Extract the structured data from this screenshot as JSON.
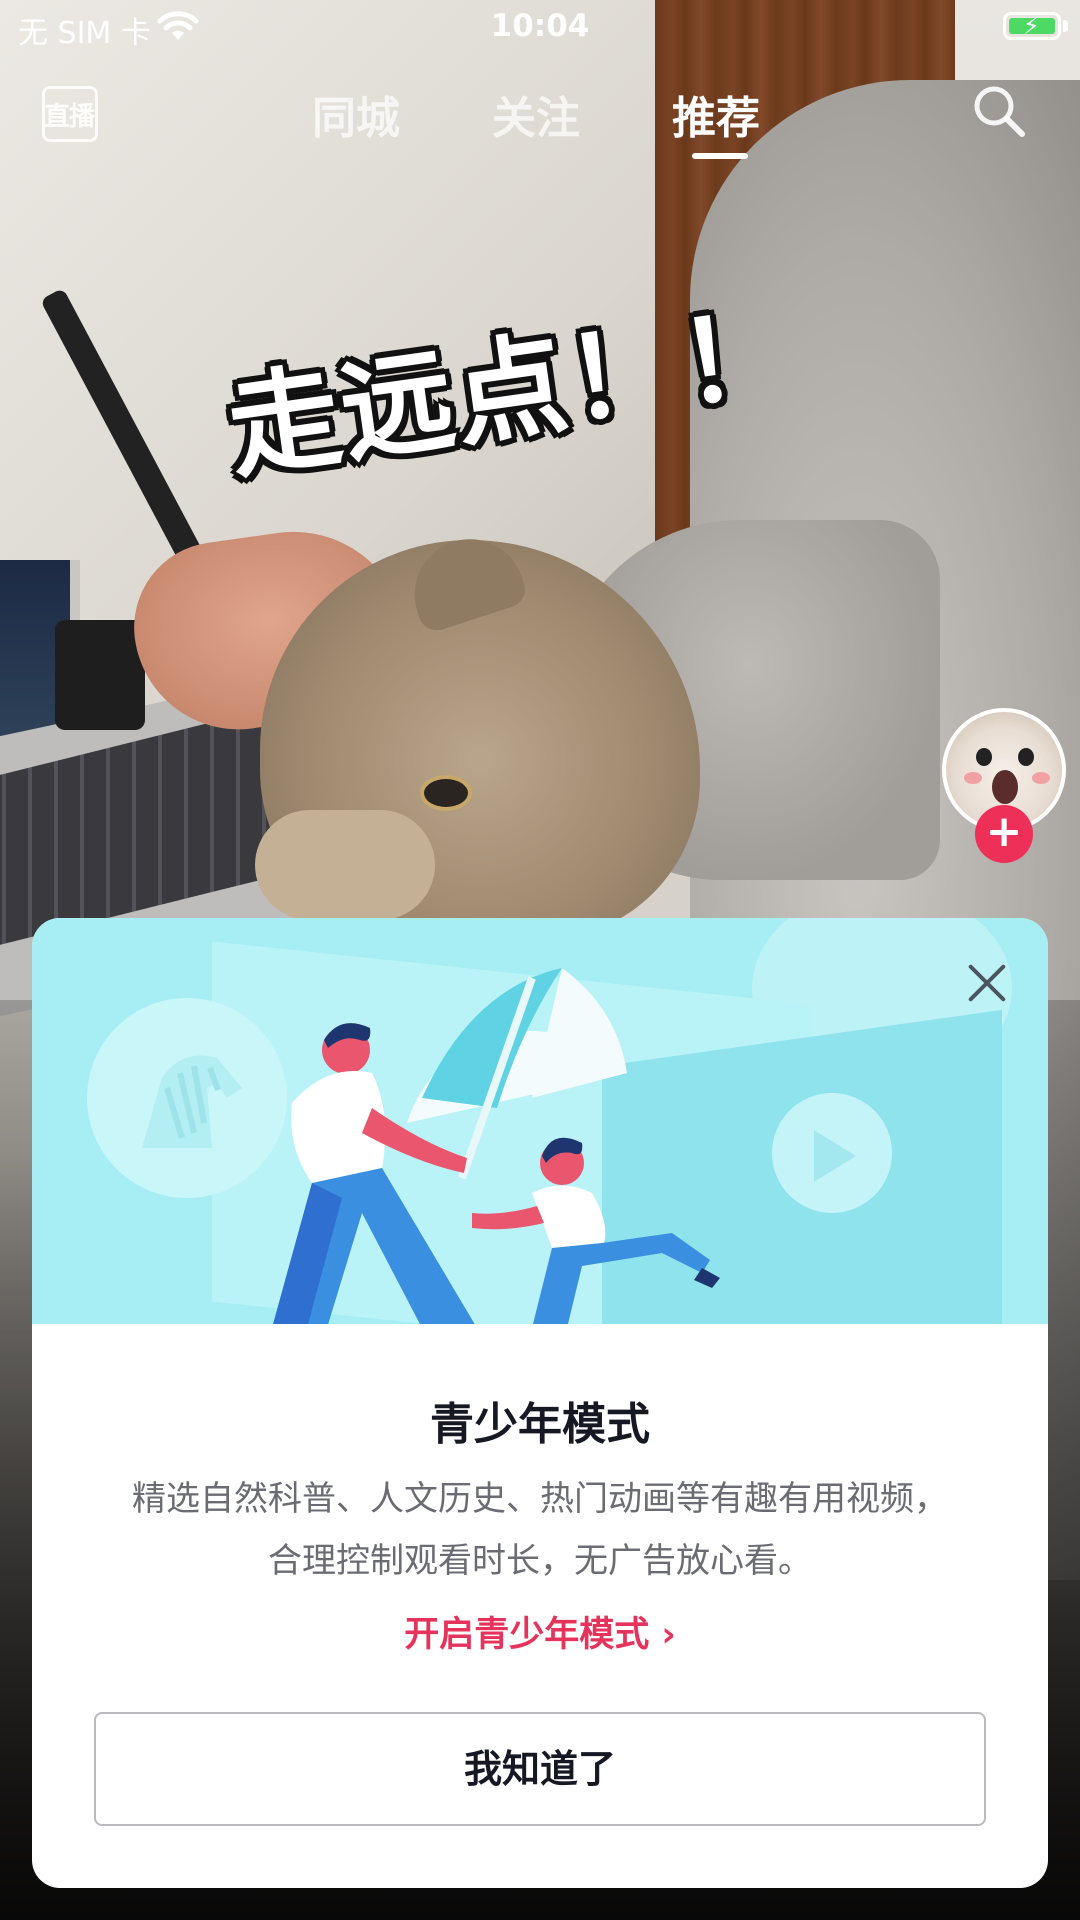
{
  "status_bar": {
    "carrier": "无 SIM 卡",
    "time": "10:04",
    "battery_color": "#4cd964"
  },
  "top_nav": {
    "live_label": "直播",
    "tabs": [
      {
        "label": "同城",
        "active": false
      },
      {
        "label": "关注",
        "active": false
      },
      {
        "label": "推荐",
        "active": true
      }
    ],
    "search_icon": "search-icon"
  },
  "video": {
    "sticker_text": "走远点！！"
  },
  "right_rail": {
    "follow_symbol": "+",
    "follow_color": "#ee2f58"
  },
  "modal": {
    "title": "青少年模式",
    "description_line1": "精选自然科普、人文历史、热门动画等有趣有用视频，",
    "description_line2": "合理控制观看时长，无广告放心看。",
    "enable_link": "开启青少年模式 ›",
    "confirm_button": "我知道了",
    "accent_color": "#e6335c",
    "hero_color": "#a6eef4"
  }
}
